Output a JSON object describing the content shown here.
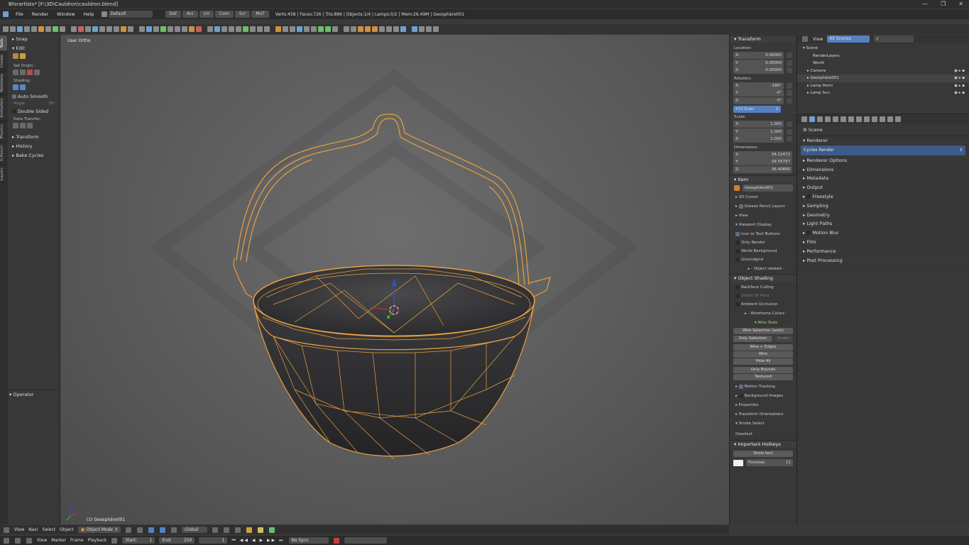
{
  "window": {
    "title": "Bforartists* [F:\\3D\\Cauldron\\cauldron.blend]",
    "controls": [
      "—",
      "❐",
      "✕"
    ]
  },
  "menu": {
    "items": [
      "File",
      "Render",
      "Window",
      "Help"
    ],
    "layout": "Default",
    "tabs": [
      "Def",
      "Ani",
      "UV",
      "Com",
      "Scr",
      "MoT"
    ],
    "stats": "Verts:458 | Faces:726 | Tris:896 | Objects:1/4 | Lamps:0/2 | Mem:26.49M | Geosphäre001"
  },
  "tool_tabs": [
    "Tools",
    "Create",
    "Relations",
    "Animation",
    "Physics",
    "G.Pencil",
    "Layers"
  ],
  "toolshelf": {
    "snap": "Snap",
    "edit": "Edit",
    "set_origin": "Set Origin:",
    "shading": "Shading:",
    "auto_smooth": "Auto Smooth",
    "angle_label": "Angle:",
    "angle_value": "30°",
    "double_sided": "Double Sided",
    "data_transfer": "Data Transfer:",
    "transform": "Transform",
    "history": "History",
    "bake_cycles": "Bake Cycles",
    "operator": "Operator"
  },
  "viewport": {
    "view_label": "User Ortho",
    "object_label": "(1) Geosphäre001"
  },
  "npanel": {
    "transform": "Transform",
    "location": "Location:",
    "loc": [
      {
        "axis": "X:",
        "value": "0.00000"
      },
      {
        "axis": "Y:",
        "value": "0.00000"
      },
      {
        "axis": "Z:",
        "value": "0.00000"
      }
    ],
    "rotation": "Rotation:",
    "rot": [
      {
        "axis": "X:",
        "value": "-180°"
      },
      {
        "axis": "Y:",
        "value": "-0°"
      },
      {
        "axis": "Z:",
        "value": "0°"
      }
    ],
    "rot_mode": "XYZ Euler",
    "scale": "Scale:",
    "scl": [
      {
        "axis": "X:",
        "value": "1.000"
      },
      {
        "axis": "Y:",
        "value": "1.000"
      },
      {
        "axis": "Z:",
        "value": "1.000"
      }
    ],
    "dimensions": "Dimensions:",
    "dim": [
      {
        "axis": "X:",
        "value": "34.12472"
      },
      {
        "axis": "Y:",
        "value": "29.55797"
      },
      {
        "axis": "Z:",
        "value": "36.40895"
      }
    ],
    "item": "Item",
    "item_name": "Geosphäre001",
    "cursor": "3D Cursor",
    "gp_layers": "Grease Pencil Layers",
    "view": "View",
    "viewport_display": "Viewport Display",
    "icon_text": "Icon or Text Buttons",
    "only_render": "Only Render",
    "world_bg": "World Background",
    "groundgrid": "Groundgrid",
    "object_related": "- Object related -",
    "object_shading": "Object Shading",
    "backface": "Backface Culling",
    "dof": "Depth Of Field",
    "ao": "Ambient Occlusion",
    "wire_colors": "- Wireframe Colors -",
    "wire_tools": "Wire Tools",
    "wire_sel": "Wire Selection (auto)",
    "only_sel": "Only Selection",
    "invert": "Invert",
    "wire_edges": "Wire + Edges",
    "wire": "Wire",
    "hide_all": "Hide All",
    "only_bounds": "Only Bounds",
    "textured": "Textured",
    "motion_tracking": "Motion Tracking",
    "bg_images": "Background Images",
    "properties": "Properties",
    "transform_orient": "Transform Orientations",
    "stroke_select": "Stroke Select",
    "deselect": "Deselect",
    "hotkeys": "Important Hotkeys",
    "show_text": "Show text",
    "fontsize_label": "Fontsize:",
    "fontsize_value": "11"
  },
  "outliner": {
    "view": "View",
    "filter": "All Scenes",
    "items": [
      "Scene",
      "RenderLayers",
      "World",
      "Camera",
      "Geosphäre001",
      "Lamp Hemi",
      "Lamp Sun"
    ]
  },
  "properties": {
    "context": "Scene",
    "renderer_label": "Renderer",
    "renderer": "Cycles Render",
    "panels": [
      "Renderer Options",
      "Dimensions",
      "Metadata",
      "Output",
      "Freestyle",
      "Sampling",
      "Geometry",
      "Light Paths",
      "Motion Blur",
      "Film",
      "Performance",
      "Post Processing"
    ]
  },
  "header3d": {
    "menus": [
      "View",
      "Navi",
      "Select",
      "Object"
    ],
    "mode": "Object Mode",
    "orientation": "Global"
  },
  "timeline": {
    "menus": [
      "View",
      "Marker",
      "Frame",
      "Playback"
    ],
    "start_label": "Start:",
    "start": "1",
    "end_label": "End:",
    "end": "250",
    "current": "1",
    "sync": "No Sync"
  },
  "colors": {
    "wire": "#e8a040",
    "accent": "#5680c2"
  }
}
